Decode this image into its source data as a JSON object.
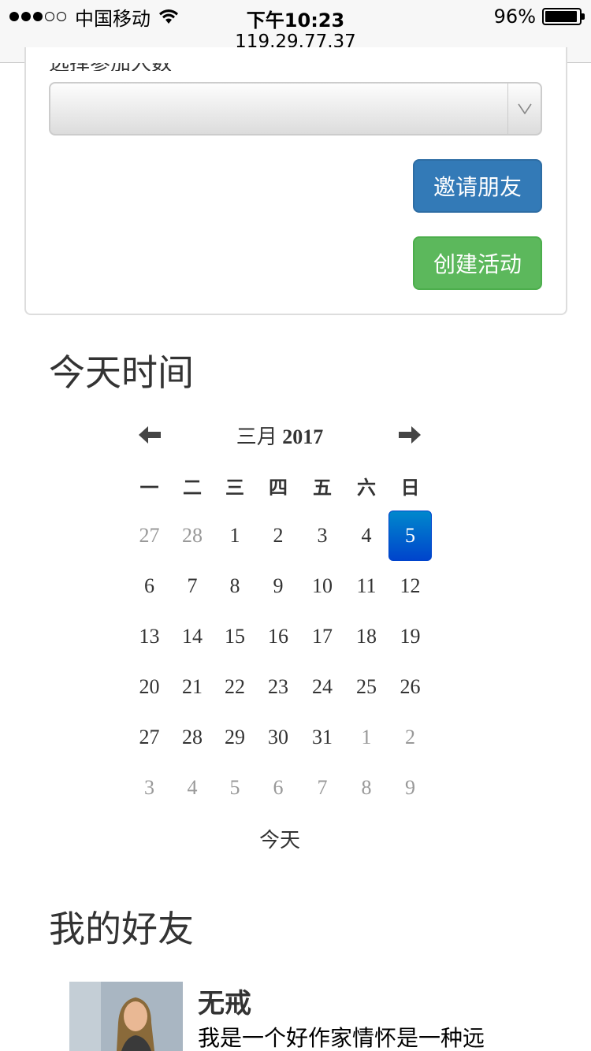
{
  "status_bar": {
    "carrier": "中国移动",
    "time": "下午10:23",
    "url": "119.29.77.37",
    "battery": "96%",
    "battery_level": 0.96
  },
  "form": {
    "field_label": "选择参加人数",
    "select_value": "",
    "invite_button": "邀请朋友",
    "create_button": "创建活动"
  },
  "today_section": {
    "title": "今天时间"
  },
  "calendar": {
    "month_label": "三月",
    "year": "2017",
    "weekdays": [
      "一",
      "二",
      "三",
      "四",
      "五",
      "六",
      "日"
    ],
    "weeks": [
      [
        "27",
        "28",
        "1",
        "2",
        "3",
        "4",
        "5"
      ],
      [
        "6",
        "7",
        "8",
        "9",
        "10",
        "11",
        "12"
      ],
      [
        "13",
        "14",
        "15",
        "16",
        "17",
        "18",
        "19"
      ],
      [
        "20",
        "21",
        "22",
        "23",
        "24",
        "25",
        "26"
      ],
      [
        "27",
        "28",
        "29",
        "30",
        "31",
        "1",
        "2"
      ],
      [
        "3",
        "4",
        "5",
        "6",
        "7",
        "8",
        "9"
      ]
    ],
    "selected": "5",
    "today_button": "今天"
  },
  "friends_section": {
    "title": "我的好友",
    "friends": [
      {
        "name": "无戒",
        "description": "我是一个好作家情怀是一种远"
      }
    ]
  }
}
